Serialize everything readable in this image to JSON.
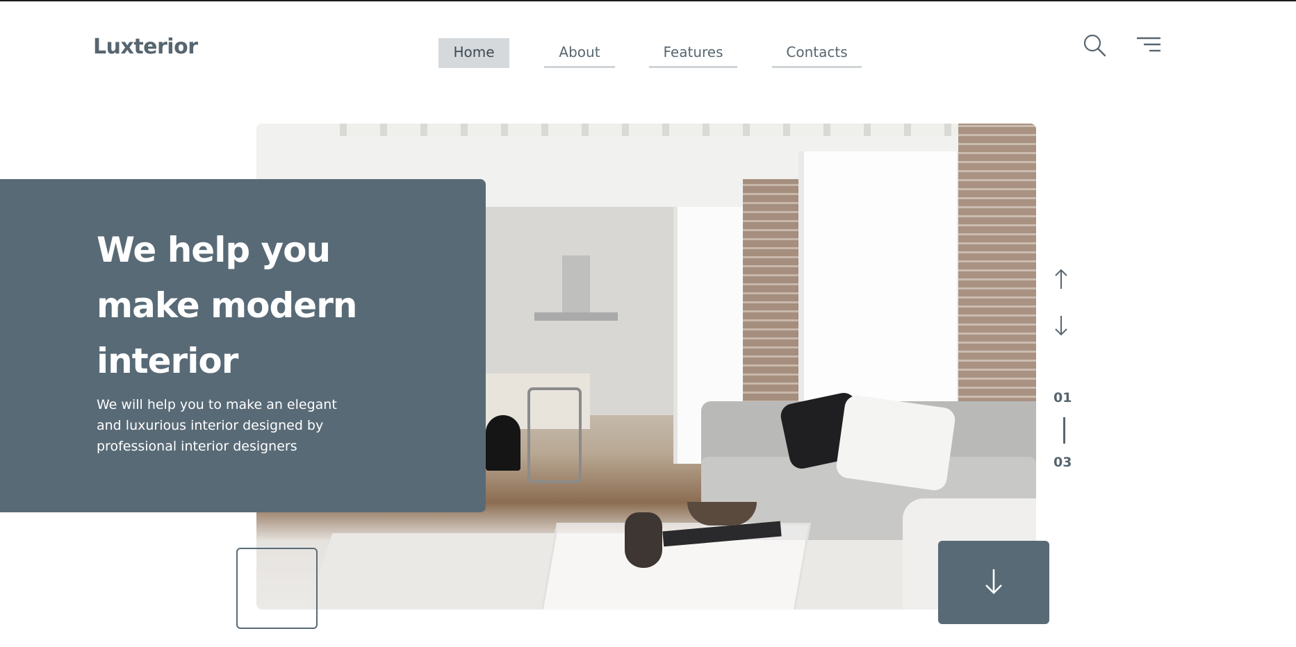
{
  "brand": {
    "logo": "Luxterior"
  },
  "nav": {
    "items": [
      {
        "label": "Home",
        "active": true
      },
      {
        "label": "About",
        "active": false
      },
      {
        "label": "Features",
        "active": false
      },
      {
        "label": "Contacts",
        "active": false
      }
    ]
  },
  "header_icons": [
    "search-icon",
    "menu-icon"
  ],
  "hero": {
    "headline": "We help you make modern interior",
    "subtext": "We will help you to make an elegant and luxurious interior designed by professional interior designers",
    "image_alt": "Modern Scandinavian living room and kitchen interior"
  },
  "slider": {
    "current": "01",
    "total": "03",
    "up_icon": "arrow-up-icon",
    "down_icon": "arrow-down-icon"
  },
  "scroll_button": {
    "icon": "arrow-down-icon"
  },
  "colors": {
    "accent": "#586a76",
    "text": "#57656f",
    "nav_active_bg": "#d5d9dc",
    "nav_underline": "#cfd4d7",
    "background": "#ffffff"
  }
}
